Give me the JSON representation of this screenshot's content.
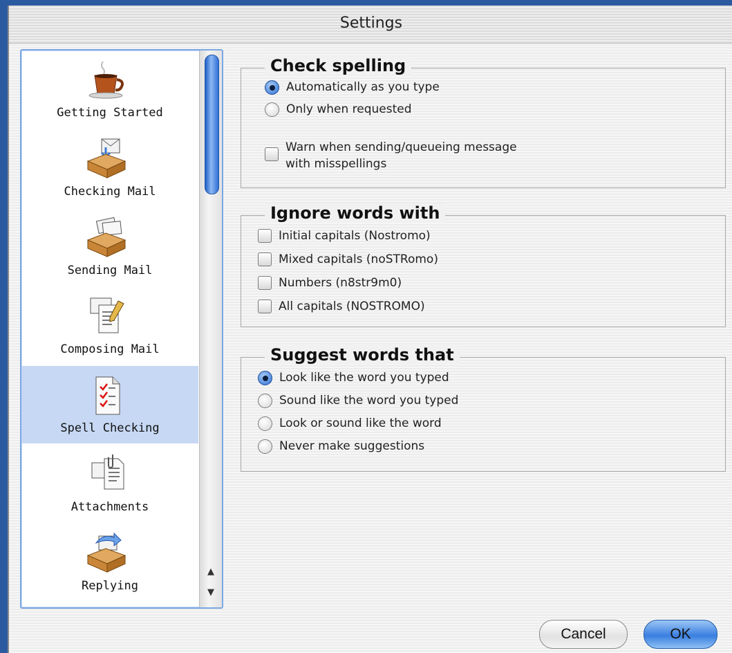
{
  "window": {
    "title": "Settings"
  },
  "sidebar": {
    "items": [
      {
        "label": "Getting Started",
        "icon": "coffee-cup-icon"
      },
      {
        "label": "Checking Mail",
        "icon": "inbox-tray-icon"
      },
      {
        "label": "Sending Mail",
        "icon": "outbox-tray-icon"
      },
      {
        "label": "Composing Mail",
        "icon": "compose-document-icon"
      },
      {
        "label": "Spell Checking",
        "icon": "spell-check-document-icon",
        "selected": true
      },
      {
        "label": "Attachments",
        "icon": "attachment-documents-icon"
      },
      {
        "label": "Replying",
        "icon": "reply-tray-icon"
      }
    ],
    "scroll": {
      "up": "▲",
      "down": "▼"
    }
  },
  "check_spelling": {
    "title": "Check spelling",
    "options": [
      {
        "label": "Automatically as you type",
        "selected": true
      },
      {
        "label": "Only when requested",
        "selected": false
      }
    ],
    "warn": {
      "line1": "Warn when sending/queueing message",
      "line2": "with misspellings",
      "checked": false
    }
  },
  "ignore_words": {
    "title": "Ignore words with",
    "options": [
      {
        "label": "Initial capitals (Nostromo)",
        "checked": false
      },
      {
        "label": "Mixed capitals (noSTRomo)",
        "checked": false
      },
      {
        "label": "Numbers (n8str9m0)",
        "checked": false
      },
      {
        "label": "All capitals (NOSTROMO)",
        "checked": false
      }
    ]
  },
  "suggest_words": {
    "title": "Suggest words that",
    "options": [
      {
        "label": "Look like the word you typed",
        "selected": true
      },
      {
        "label": "Sound like the word you typed",
        "selected": false
      },
      {
        "label": "Look or sound like the word",
        "selected": false
      },
      {
        "label": "Never make suggestions",
        "selected": false
      }
    ]
  },
  "buttons": {
    "cancel": "Cancel",
    "ok": "OK"
  },
  "colors": {
    "selection": "#c6d8f3",
    "accent": "#2d6fd3",
    "desktop": "#2c5aa0"
  }
}
